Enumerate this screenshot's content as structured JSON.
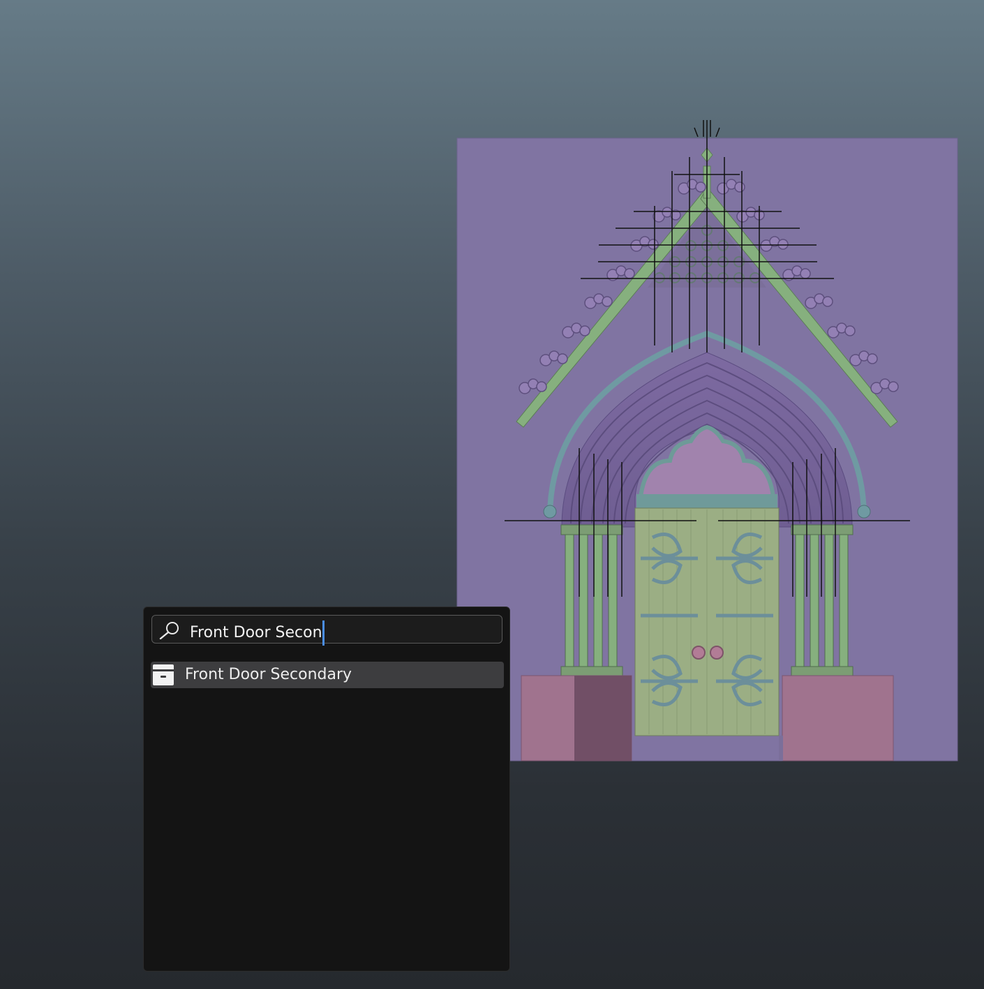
{
  "search": {
    "query": "Front Door Secon",
    "icon": "search-icon"
  },
  "results": [
    {
      "label": "Front Door Secondary",
      "icon": "asset-box-icon",
      "selected": true
    }
  ],
  "colors": {
    "accent_caret": "#4a8de8",
    "popup_bg": "#141414",
    "selected_row": "#3d3d3f",
    "wall": "#8074a2",
    "gable_trim": "#86b07e",
    "arch_outer": "#6f9aa2",
    "door": "#9bae84",
    "plinth": "#a0738e"
  }
}
